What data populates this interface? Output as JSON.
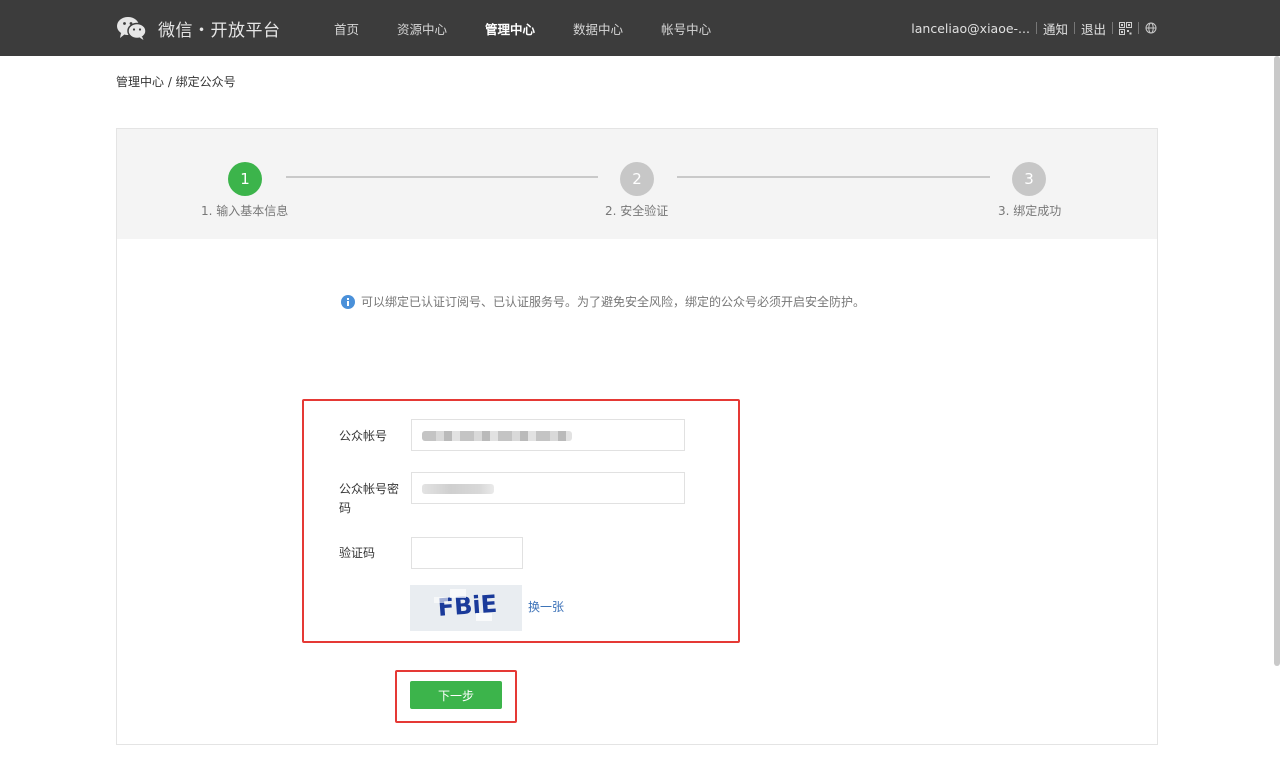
{
  "header": {
    "logo_text": "微信・开放平台",
    "nav": [
      {
        "label": "首页"
      },
      {
        "label": "资源中心"
      },
      {
        "label": "管理中心"
      },
      {
        "label": "数据中心"
      },
      {
        "label": "帐号中心"
      }
    ],
    "active_nav": "管理中心",
    "user": "lanceliao@xiaoe-...",
    "notify_label": "通知",
    "logout_label": "退出",
    "qr_icon": "qr-code-icon",
    "lang_icon": "globe-icon",
    "bar_color": "#3c3c3c"
  },
  "breadcrumb": "管理中心 / 绑定公众号",
  "steps": [
    {
      "number": "1",
      "label": "1. 输入基本信息",
      "state": "done"
    },
    {
      "number": "2",
      "label": "2. 安全验证",
      "state": "todo"
    },
    {
      "number": "3",
      "label": "3. 绑定成功",
      "state": "todo"
    }
  ],
  "notice": "可以绑定已认证订阅号、已认证服务号。为了避免安全风险，绑定的公众号必须开启安全防护。",
  "form": {
    "account_label": "公众帐号",
    "password_label_line1": "公众帐号密",
    "password_label_line2": "码",
    "captcha_label": "验证码",
    "captcha_value": "",
    "captcha_text": "FBiE",
    "refresh_label": "换一张"
  },
  "next_button": "下一步",
  "colors": {
    "accent_green": "#3cb44b",
    "highlight_red": "#e53935",
    "link_blue": "#3c72b8"
  }
}
